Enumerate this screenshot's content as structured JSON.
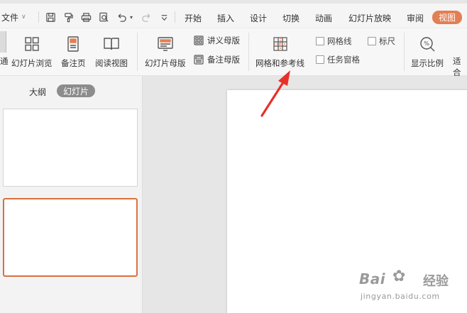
{
  "menubar": {
    "file_label": "文件",
    "tabs": [
      {
        "label": "开始"
      },
      {
        "label": "插入"
      },
      {
        "label": "设计"
      },
      {
        "label": "切换"
      },
      {
        "label": "动画"
      },
      {
        "label": "幻灯片放映"
      },
      {
        "label": "审阅"
      },
      {
        "label": "视图",
        "active": true
      }
    ],
    "quick_access_icons": [
      "save-icon",
      "format-painter-icon",
      "print-icon",
      "print-preview-icon",
      "undo-icon",
      "redo-icon",
      "customize-dropdown-icon"
    ]
  },
  "ribbon": {
    "buttons": [
      {
        "label": "幻灯片浏览",
        "icon": "slide-sorter-icon"
      },
      {
        "label": "备注页",
        "icon": "notes-page-icon"
      },
      {
        "label": "阅读视图",
        "icon": "reading-view-icon"
      },
      {
        "label": "幻灯片母版",
        "icon": "slide-master-icon"
      },
      {
        "label": "网格和参考线",
        "icon": "grid-guides-icon"
      },
      {
        "label": "显示比例",
        "icon": "zoom-icon"
      },
      {
        "label": "适合",
        "icon": "fit-icon"
      }
    ],
    "small_buttons": [
      {
        "label": "讲义母版",
        "icon": "handout-master-icon"
      },
      {
        "label": "备注母版",
        "icon": "notes-master-icon"
      }
    ],
    "checkboxes": [
      {
        "label": "网格线",
        "checked": false
      },
      {
        "label": "标尺",
        "checked": false
      },
      {
        "label": "任务窗格",
        "checked": false
      }
    ],
    "partial_left_label": "通"
  },
  "left_panel": {
    "tab_outline": "大纲",
    "tab_slides": "幻灯片",
    "slides_count_visible": 2,
    "selected_slide": 2
  },
  "watermark": {
    "logo_text": "Bai",
    "logo_icon": "paw-icon",
    "logo_text_cn": "经验",
    "url": "jingyan.baidu.com"
  },
  "colors": {
    "accent": "#e37f54",
    "selection_border": "#d9713f",
    "annotation_arrow": "#e8302a"
  }
}
